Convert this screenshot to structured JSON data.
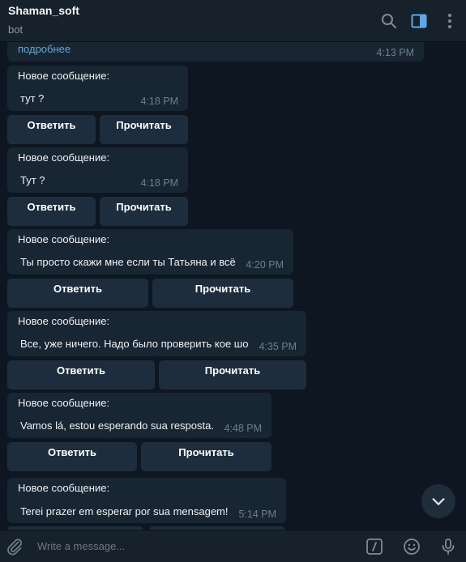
{
  "header": {
    "title": "Shaman_soft",
    "subtitle": "bot",
    "icons": [
      "search-icon",
      "sidebar-toggle-icon",
      "more-vertical-icon"
    ]
  },
  "messages": [
    {
      "link": "подробнее",
      "time": "4:13 PM"
    },
    {
      "heading": "Новое сообщение:",
      "text": "тут ?",
      "time": "4:18 PM",
      "reply": "Ответить",
      "read": "Прочитать"
    },
    {
      "heading": "Новое сообщение:",
      "text": "Тут ?",
      "time": "4:18 PM",
      "reply": "Ответить",
      "read": "Прочитать"
    },
    {
      "heading": "Новое сообщение:",
      "text": "Ты просто скажи мне если ты Татьяна и всё",
      "time": "4:20 PM",
      "reply": "Ответить",
      "read": "Прочитать"
    },
    {
      "heading": "Новое сообщение:",
      "text": "Все, уже ничего. Надо было проверить кое шо",
      "time": "4:35 PM",
      "reply": "Ответить",
      "read": "Прочитать"
    },
    {
      "heading": "Новое сообщение:",
      "text": "Vamos lá, estou esperando sua resposta.",
      "time": "4:48 PM",
      "reply": "Ответить",
      "read": "Прочитать"
    },
    {
      "heading": "Новое сообщение:",
      "text": "Terei prazer em esperar por sua mensagem!",
      "time": "5:14 PM"
    }
  ],
  "composer": {
    "placeholder": "Write a message...",
    "icons": [
      "attach-icon",
      "commands-icon",
      "emoji-icon",
      "microphone-icon"
    ]
  },
  "colors": {
    "background": "#0e1621",
    "panel": "#17212b",
    "bubble": "#182533",
    "button": "#1d2d3d",
    "accent": "#64a6d6",
    "timestamp": "#6d7f8f"
  }
}
